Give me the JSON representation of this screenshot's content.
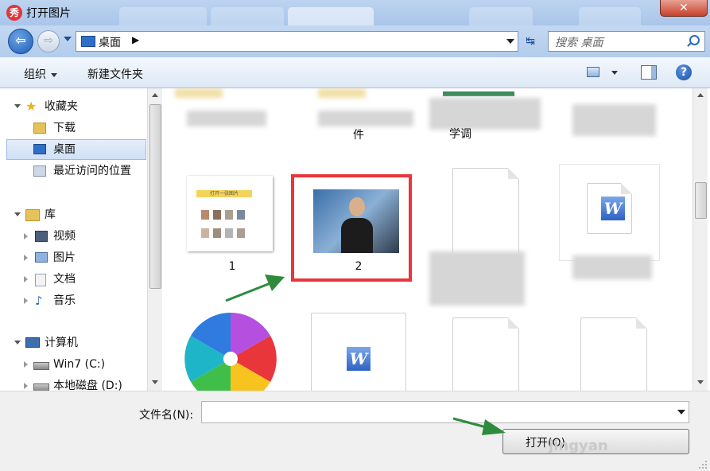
{
  "window": {
    "title": "打开图片",
    "app_icon_text": "秀",
    "close_glyph": "✕"
  },
  "navigation": {
    "back_glyph": "⇦",
    "forward_glyph": "⇨",
    "refresh_glyph": "↹"
  },
  "address": {
    "location": "桌面",
    "separator": "▶"
  },
  "search": {
    "placeholder": "搜索 桌面"
  },
  "toolbar": {
    "organize_label": "组织",
    "new_folder_label": "新建文件夹",
    "help_glyph": "?"
  },
  "sidebar": {
    "favorites": {
      "label": "收藏夹",
      "items": [
        {
          "label": "下载"
        },
        {
          "label": "桌面"
        },
        {
          "label": "最近访问的位置"
        }
      ]
    },
    "libraries": {
      "label": "库",
      "items": [
        {
          "label": "视频"
        },
        {
          "label": "图片"
        },
        {
          "label": "文档"
        },
        {
          "label": "音乐"
        }
      ]
    },
    "computer": {
      "label": "计算机",
      "items": [
        {
          "label": "Win7 (C:)"
        },
        {
          "label": "本地磁盘 (D:)"
        }
      ]
    }
  },
  "files": {
    "row1": [
      {
        "label": "件"
      },
      {
        "label": "学调"
      }
    ],
    "row2": [
      {
        "label": "1"
      },
      {
        "label": "2"
      }
    ]
  },
  "thumb1": {
    "banner_text": "打开一张图片"
  },
  "word_letter": "W",
  "bottom": {
    "filename_label": "文件名(N):",
    "filename_value": "",
    "open_button_label": "打开(O)"
  },
  "watermark": "jingyan",
  "colors": {
    "highlight": "#e8363b",
    "arrow": "#2e8b3c",
    "accent": "#1d5cb8"
  }
}
